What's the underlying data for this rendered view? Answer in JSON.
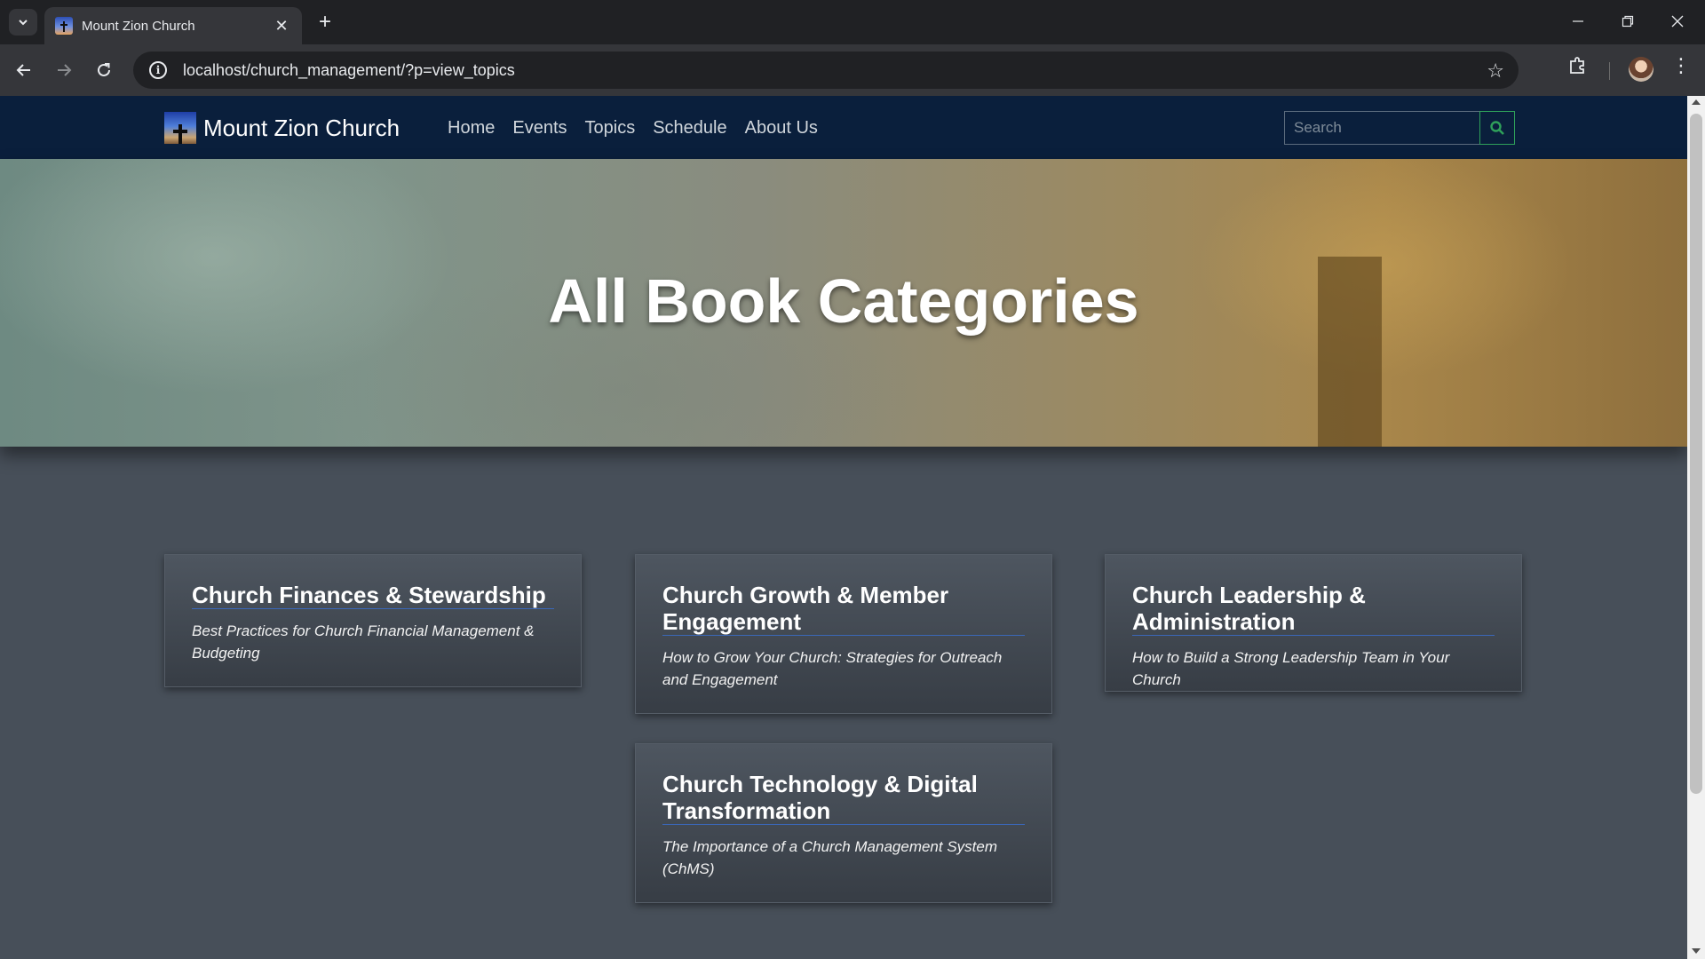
{
  "browser": {
    "tab_title": "Mount Zion Church",
    "url": "localhost/church_management/?p=view_topics"
  },
  "site": {
    "brand_name": "Mount Zion Church",
    "nav": [
      "Home",
      "Events",
      "Topics",
      "Schedule",
      "About Us"
    ],
    "search_placeholder": "Search"
  },
  "hero": {
    "title": "All Book Categories"
  },
  "categories": [
    {
      "title": "Church Finances & Stewardship",
      "subtitle": "Best Practices for Church Financial Management & Budgeting"
    },
    {
      "title": "Church Growth & Member Engagement",
      "subtitle": "How to Grow Your Church: Strategies for Outreach and Engagement"
    },
    {
      "title": "Church Leadership & Administration",
      "subtitle": "How to Build a Strong Leadership Team in Your Church"
    },
    {
      "title": "Church Technology & Digital Transformation",
      "subtitle": "The Importance of a Church Management System (ChMS)"
    }
  ],
  "colors": {
    "navbar": "#0a1f3c",
    "page_background": "#474f59",
    "search_button_accent": "#2fa05a",
    "title_underline": "#3b67b8"
  }
}
